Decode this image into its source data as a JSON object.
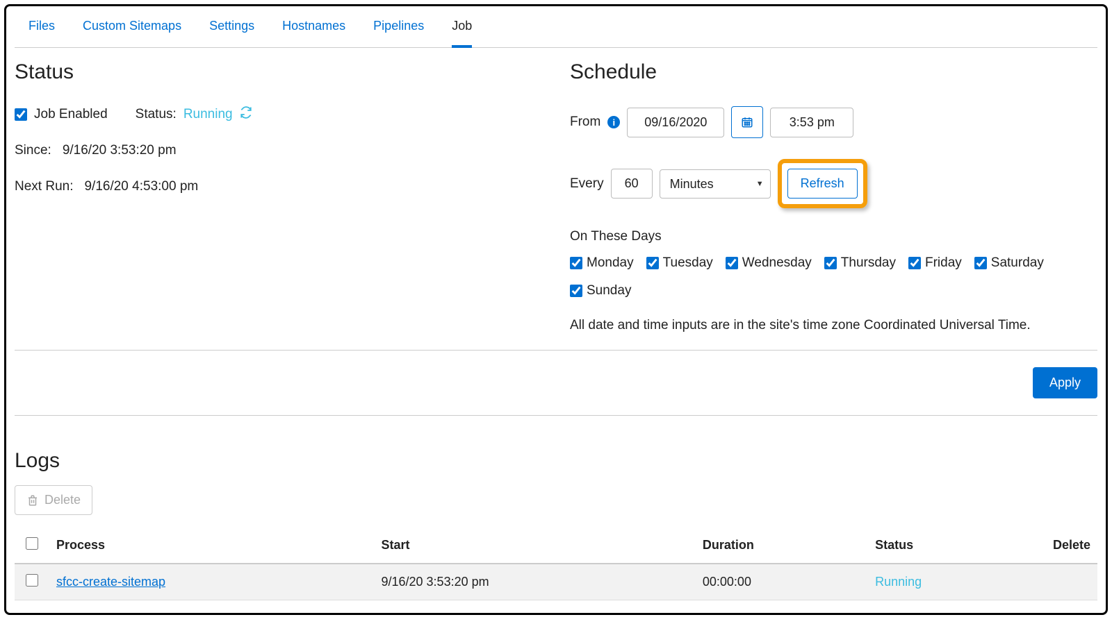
{
  "nav": {
    "tabs": [
      {
        "label": "Files"
      },
      {
        "label": "Custom Sitemaps"
      },
      {
        "label": "Settings"
      },
      {
        "label": "Hostnames"
      },
      {
        "label": "Pipelines"
      },
      {
        "label": "Job"
      }
    ],
    "activeIndex": 5
  },
  "status": {
    "heading": "Status",
    "job_enabled_label": "Job Enabled",
    "job_enabled_checked": true,
    "status_label": "Status:",
    "status_value": "Running",
    "since_label": "Since:",
    "since_value": "9/16/20  3:53:20 pm",
    "next_run_label": "Next Run:",
    "next_run_value": "9/16/20  4:53:00 pm"
  },
  "schedule": {
    "heading": "Schedule",
    "from_label": "From",
    "from_date": "09/16/2020",
    "from_time": "3:53 pm",
    "every_label": "Every",
    "every_value": "60",
    "every_unit": "Minutes",
    "refresh_label": "Refresh",
    "on_days_label": "On These Days",
    "days": [
      {
        "label": "Monday",
        "checked": true
      },
      {
        "label": "Tuesday",
        "checked": true
      },
      {
        "label": "Wednesday",
        "checked": true
      },
      {
        "label": "Thursday",
        "checked": true
      },
      {
        "label": "Friday",
        "checked": true
      },
      {
        "label": "Saturday",
        "checked": true
      },
      {
        "label": "Sunday",
        "checked": true
      }
    ],
    "timezone_note": "All date and time inputs are in the site's time zone Coordinated Universal Time."
  },
  "apply": {
    "label": "Apply"
  },
  "logs": {
    "heading": "Logs",
    "delete_label": "Delete",
    "columns": {
      "process": "Process",
      "start": "Start",
      "duration": "Duration",
      "status": "Status",
      "delete": "Delete"
    },
    "rows": [
      {
        "process": "sfcc-create-sitemap",
        "start": "9/16/20 3:53:20 pm",
        "duration": "00:00:00",
        "status": "Running"
      }
    ]
  }
}
